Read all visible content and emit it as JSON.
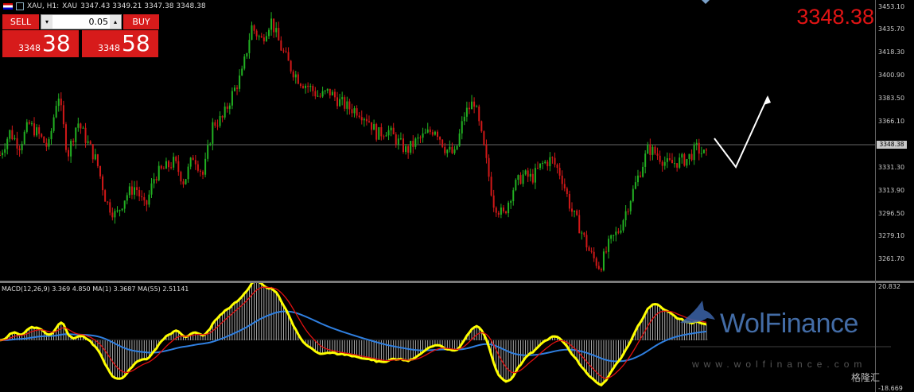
{
  "header": {
    "symbol": "XAU, H1:",
    "symbol_name": "XAU",
    "ohlc": "3347.43 3349.21 3347.38 3348.38"
  },
  "trade_panel": {
    "sell_label": "SELL",
    "buy_label": "BUY",
    "lot_value": "0.05",
    "dec_symbol": "▾",
    "inc_symbol": "▴",
    "sell_price_small": "3348",
    "sell_price_big": "38",
    "buy_price_small": "3348",
    "buy_price_big": "58"
  },
  "current_price": "3348.38",
  "current_price_tag": "3348.38",
  "price_axis": [
    "3453.10",
    "3435.70",
    "3418.30",
    "3400.90",
    "3383.50",
    "3366.10",
    "3331.30",
    "3313.90",
    "3296.50",
    "3279.10",
    "3261.70"
  ],
  "macd": {
    "label": "MACD(12,26,9) 3.369 4.850 MA(1) 3.3687 MA(55) 2.51141",
    "axis_top": "20.832",
    "axis_bottom": "-18.669"
  },
  "logo": {
    "name": "WolFinance",
    "url": "www.wolfinance.com"
  },
  "watermark": "格隆汇",
  "colors": {
    "bull": "#22b022",
    "bear": "#d01818",
    "macd_main": "#ffff00",
    "macd_signal": "#e01010",
    "macd_ma": "#2f7fe0",
    "sell_buy": "#d71b1b"
  },
  "chart_data": {
    "type": "candlestick",
    "symbol": "XAU",
    "timeframe": "H1",
    "ylim": [
      3255,
      3455
    ],
    "close_points": [
      3345,
      3362,
      3352,
      3368,
      3360,
      3350,
      3392,
      3345,
      3370,
      3355,
      3340,
      3310,
      3300,
      3315,
      3322,
      3305,
      3330,
      3335,
      3340,
      3325,
      3345,
      3330,
      3368,
      3372,
      3390,
      3405,
      3440,
      3430,
      3445,
      3425,
      3410,
      3400,
      3395,
      3388,
      3392,
      3385,
      3380,
      3378,
      3372,
      3360,
      3364,
      3356,
      3348,
      3355,
      3360,
      3365,
      3350,
      3345,
      3375,
      3385,
      3350,
      3310,
      3300,
      3320,
      3330,
      3328,
      3338,
      3342,
      3330,
      3305,
      3290,
      3272,
      3262,
      3280,
      3290,
      3310,
      3330,
      3350,
      3345,
      3338,
      3340,
      3342,
      3350,
      3344
    ],
    "current": 3348.38,
    "macd_ylim": [
      -18.669,
      20.832
    ]
  }
}
